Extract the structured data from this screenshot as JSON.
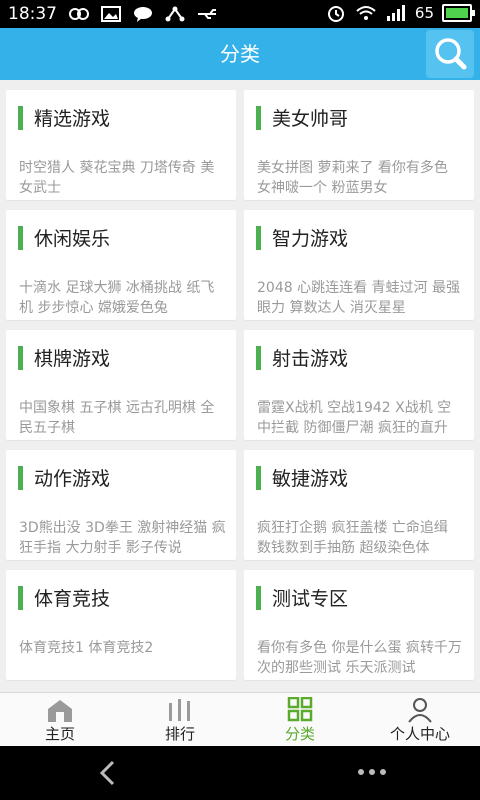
{
  "status": {
    "time": "18:37",
    "battery_level": "65"
  },
  "header": {
    "title": "分类"
  },
  "categories": [
    {
      "title": "精选游戏",
      "desc": "时空猎人 葵花宝典 刀塔传奇 美女武士"
    },
    {
      "title": "美女帅哥",
      "desc": "美女拼图 萝莉来了 看你有多色 女神啵一个 粉蓝男女"
    },
    {
      "title": "休闲娱乐",
      "desc": "十滴水 足球大狮 冰桶挑战 纸飞机 步步惊心 嫦娥爱色兔"
    },
    {
      "title": "智力游戏",
      "desc": "2048 心跳连连看 青蛙过河 最强眼力 算数达人 消灭星星"
    },
    {
      "title": "棋牌游戏",
      "desc": "中国象棋 五子棋 远古孔明棋 全民五子棋"
    },
    {
      "title": "射击游戏",
      "desc": "雷霆X战机 空战1942 X战机 空中拦截 防御僵尸潮 疯狂的直升"
    },
    {
      "title": "动作游戏",
      "desc": "3D熊出没 3D拳王 激射神经猫 疯狂手指 大力射手 影子传说"
    },
    {
      "title": "敏捷游戏",
      "desc": "疯狂打企鹅 疯狂盖楼 亡命追缉 数钱数到手抽筋 超级染色体"
    },
    {
      "title": "体育竞技",
      "desc": "体育竞技1 体育竞技2"
    },
    {
      "title": "测试专区",
      "desc": "看你有多色 你是什么蛋 疯转千万次的那些测试 乐天派测试"
    }
  ],
  "tabs": [
    {
      "label": "主页",
      "icon": "home-icon"
    },
    {
      "label": "排行",
      "icon": "ranking-icon"
    },
    {
      "label": "分类",
      "icon": "category-icon",
      "active": true
    },
    {
      "label": "个人中心",
      "icon": "person-icon"
    }
  ],
  "colors": {
    "header": "#33b1e8",
    "accent_green": "#4caf50",
    "tab_active": "#5aaa2e"
  }
}
